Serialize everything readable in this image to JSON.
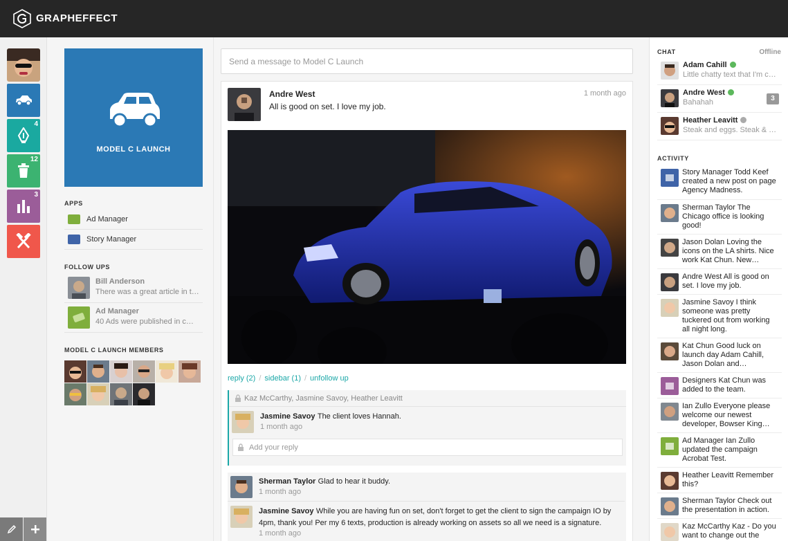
{
  "app": {
    "brand": "GRAPHEFFECT"
  },
  "rail": {
    "tiles": [
      {
        "name": "car",
        "color": "#2b79b5",
        "badge": ""
      },
      {
        "name": "pen",
        "color": "#1aa9a0",
        "badge": "4"
      },
      {
        "name": "trash",
        "color": "#3cb371",
        "badge": "12"
      },
      {
        "name": "chart",
        "color": "#9b5d99",
        "badge": "3"
      },
      {
        "name": "tools",
        "color": "#f0574b",
        "badge": ""
      }
    ]
  },
  "group": {
    "title": "MODEL C LAUNCH",
    "apps_heading": "APPS",
    "apps": [
      {
        "label": "Ad Manager",
        "color": "#7fae3c"
      },
      {
        "label": "Story Manager",
        "color": "#3f64a8"
      }
    ],
    "followups_heading": "FOLLOW UPS",
    "followups": [
      {
        "name": "Bill Anderson",
        "text": "There was a great article in t…"
      },
      {
        "name": "Ad Manager",
        "text": "40 Ads were published in c…"
      }
    ],
    "members_heading": "MODEL C LAUNCH MEMBERS"
  },
  "composer": {
    "placeholder": "Send a message to Model C Launch"
  },
  "post": {
    "author": "Andre West",
    "body": "All is good on set. I love my job.",
    "time": "1 month ago",
    "actions": {
      "reply": "reply (2)",
      "sidebar": "sidebar (1)",
      "unfollow": "unfollow up"
    },
    "thread": {
      "participants": "Kaz McCarthy, Jasmine Savoy, Heather Leavitt",
      "comment": {
        "name": "Jasmine Savoy",
        "text": "The client loves Hannah.",
        "time": "1 month ago"
      },
      "reply_placeholder": "Add your reply"
    },
    "comments": [
      {
        "name": "Sherman Taylor",
        "text": "Glad to hear it buddy.",
        "time": "1 month ago"
      },
      {
        "name": "Jasmine Savoy",
        "text": "While you are having fun on set, don't forget to get the client to sign the campaign IO by 4pm, thank you! Per my 6 texts, production is already working on assets so all we need is a signature.",
        "time": "1 month ago"
      }
    ]
  },
  "chat": {
    "heading": "CHAT",
    "status": "Offline",
    "items": [
      {
        "name": "Adam Cahill",
        "message": "Little chatty text that I'm c…",
        "online": true,
        "count": ""
      },
      {
        "name": "Andre West",
        "message": "Bahahah",
        "online": true,
        "count": "3"
      },
      {
        "name": "Heather Leavitt",
        "message": "Steak and eggs. Steak & …",
        "online": false,
        "count": ""
      }
    ]
  },
  "activity": {
    "heading": "ACTIVITY",
    "items": [
      {
        "text": "Story Manager Todd Keef created a new post on page Agency Madness."
      },
      {
        "text": "Sherman Taylor The Chicago office is looking good!"
      },
      {
        "text": "Jason Dolan Loving the icons on the LA shirts. Nice work Kat Chun. New…"
      },
      {
        "text": "Andre West All is good on set. I love my job."
      },
      {
        "text": "Jasmine Savoy I think someone was pretty tuckered out from working all night long."
      },
      {
        "text": "Kat Chun Good luck on launch day Adam Cahill, Jason Dolan and…"
      },
      {
        "text": "Designers Kat Chun was added to the team."
      },
      {
        "text": "Ian Zullo Everyone please welcome our newest developer, Bowser King…"
      },
      {
        "text": "Ad Manager Ian Zullo updated the campaign Acrobat Test."
      },
      {
        "text": "Heather Leavitt Remember this?"
      },
      {
        "text": "Sherman Taylor Check out the presentation in action."
      },
      {
        "text": "Kaz McCarthy Kaz - Do you want to change out the"
      }
    ]
  }
}
